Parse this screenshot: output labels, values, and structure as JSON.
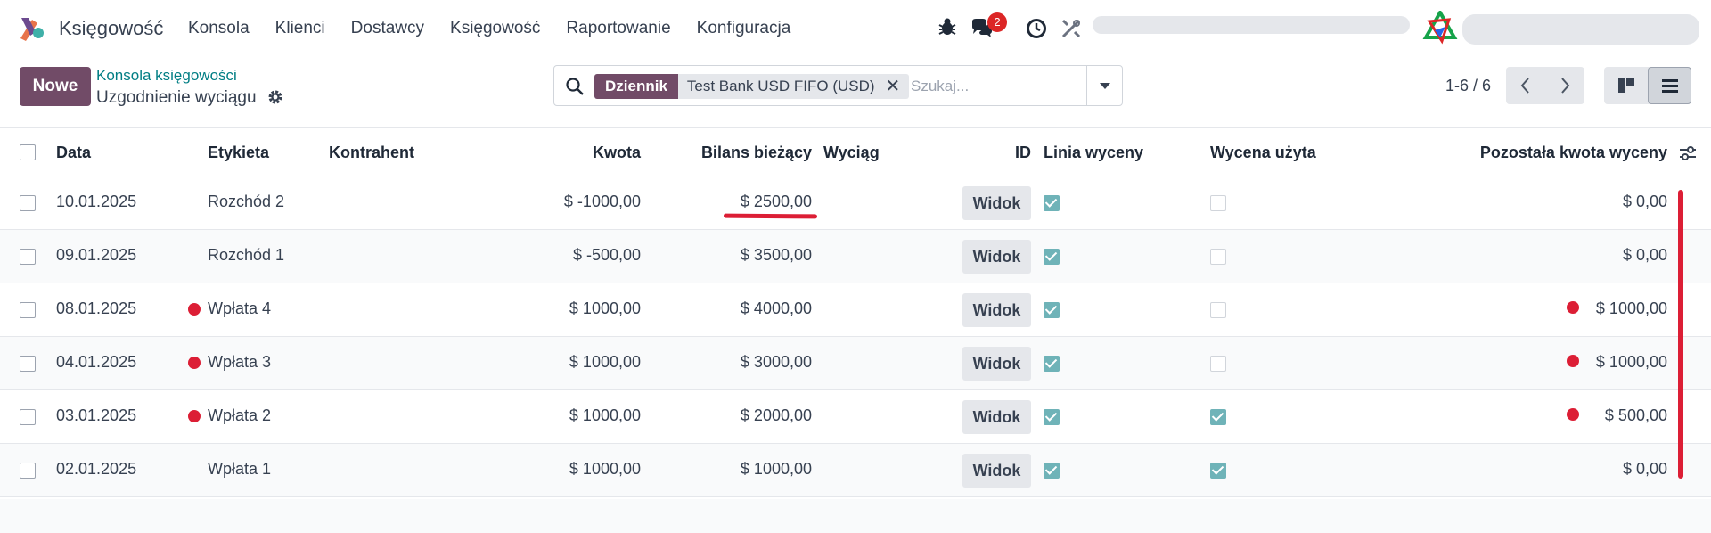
{
  "navbar": {
    "app_name": "Księgowość",
    "menu": [
      "Konsola",
      "Klienci",
      "Dostawcy",
      "Księgowość",
      "Raportowanie",
      "Konfiguracja"
    ],
    "message_count": "2"
  },
  "control_panel": {
    "new_button": "Nowe",
    "breadcrumb": "Konsola księgowości",
    "title": "Uzgodnienie wyciągu",
    "search": {
      "facet_label": "Dziennik",
      "facet_value": "Test Bank USD FIFO (USD)",
      "placeholder": "Szukaj..."
    },
    "pager": "1-6 / 6"
  },
  "table": {
    "columns": [
      "Data",
      "Etykieta",
      "Kontrahent",
      "Kwota",
      "Bilans bieżący",
      "Wyciąg",
      "ID",
      "Linia wyceny",
      "Wycena użyta",
      "Pozostała kwota wyceny"
    ],
    "rows": [
      {
        "date": "10.01.2025",
        "label": "Rozchód 2",
        "partner": "",
        "amount": "$ -1000,00",
        "balance": "$ 2500,00",
        "statement": "",
        "id_button": "Widok",
        "valuation_line": true,
        "valuation_used": false,
        "remaining": "$ 0,00",
        "label_flag": false,
        "remaining_flag": false
      },
      {
        "date": "09.01.2025",
        "label": "Rozchód 1",
        "partner": "",
        "amount": "$ -500,00",
        "balance": "$ 3500,00",
        "statement": "",
        "id_button": "Widok",
        "valuation_line": true,
        "valuation_used": false,
        "remaining": "$ 0,00",
        "label_flag": false,
        "remaining_flag": false
      },
      {
        "date": "08.01.2025",
        "label": "Wpłata 4",
        "partner": "",
        "amount": "$ 1000,00",
        "balance": "$ 4000,00",
        "statement": "",
        "id_button": "Widok",
        "valuation_line": true,
        "valuation_used": false,
        "remaining": "$ 1000,00",
        "label_flag": true,
        "remaining_flag": true
      },
      {
        "date": "04.01.2025",
        "label": "Wpłata 3",
        "partner": "",
        "amount": "$ 1000,00",
        "balance": "$ 3000,00",
        "statement": "",
        "id_button": "Widok",
        "valuation_line": true,
        "valuation_used": false,
        "remaining": "$ 1000,00",
        "label_flag": true,
        "remaining_flag": true
      },
      {
        "date": "03.01.2025",
        "label": "Wpłata 2",
        "partner": "",
        "amount": "$ 1000,00",
        "balance": "$ 2000,00",
        "statement": "",
        "id_button": "Widok",
        "valuation_line": true,
        "valuation_used": true,
        "remaining": "$ 500,00",
        "label_flag": true,
        "remaining_flag": true
      },
      {
        "date": "02.01.2025",
        "label": "Wpłata 1",
        "partner": "",
        "amount": "$ 1000,00",
        "balance": "$ 1000,00",
        "statement": "",
        "id_button": "Widok",
        "valuation_line": true,
        "valuation_used": true,
        "remaining": "$ 0,00",
        "label_flag": false,
        "remaining_flag": false
      }
    ]
  },
  "colors": {
    "brand": "#714b67",
    "link": "#017e84",
    "annotation": "#dc1e35",
    "checkbox_checked": "#6fb3b8"
  }
}
